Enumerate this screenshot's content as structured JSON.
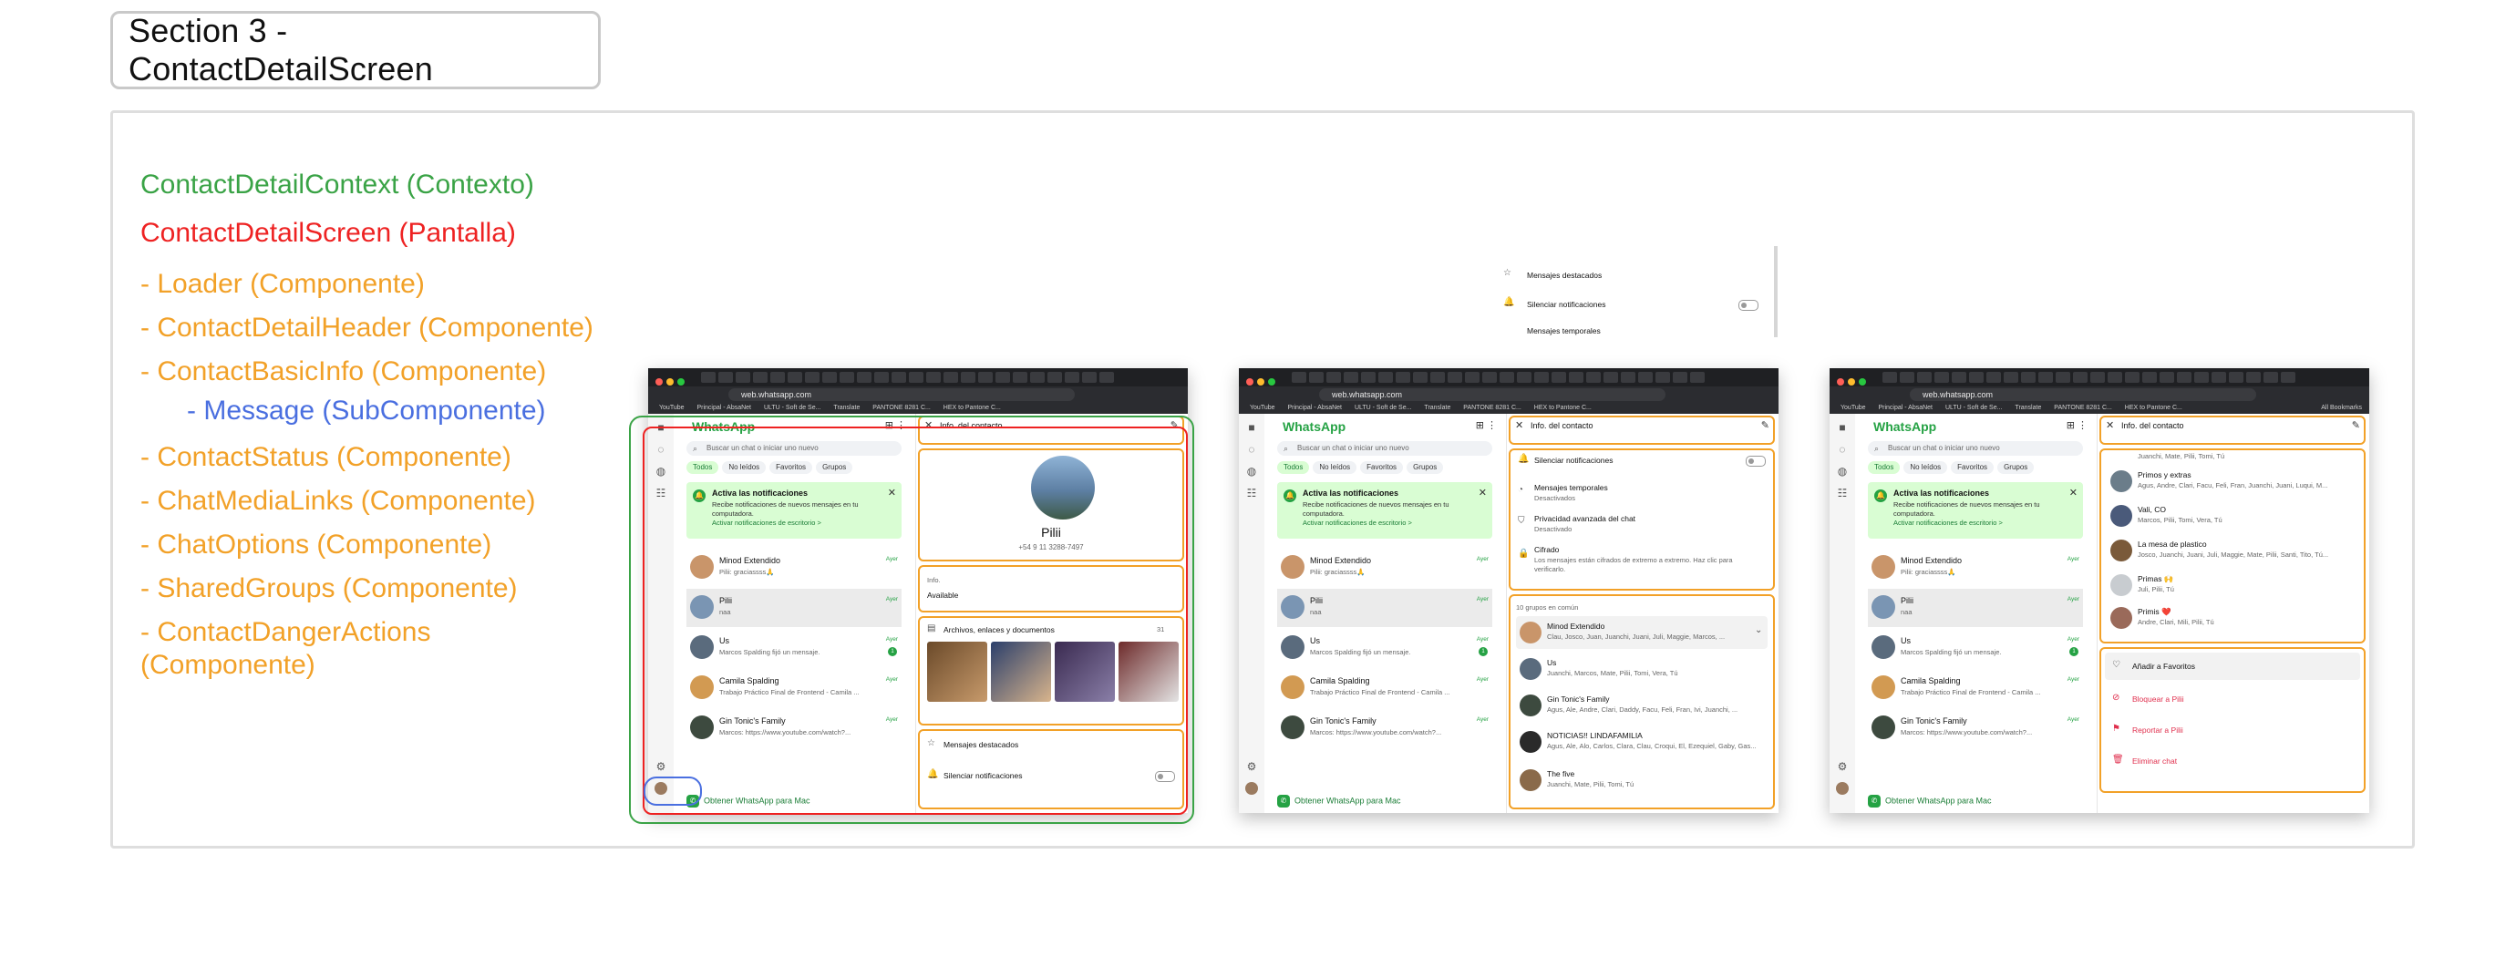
{
  "section_title": "Section 3 - ContactDetailScreen",
  "legend": [
    {
      "text": "ContactDetailContext (Contexto)",
      "color": "green"
    },
    {
      "text": "ContactDetailScreen (Pantalla)",
      "color": "red"
    },
    {
      "text": "- Loader (Componente)",
      "color": "orange"
    },
    {
      "text": "- ContactDetailHeader (Componente)",
      "color": "orange"
    },
    {
      "text": "- ContactBasicInfo (Componente)",
      "color": "orange"
    },
    {
      "text": "- Message (SubComponente)",
      "color": "blue"
    },
    {
      "text": "- ContactStatus (Componente)",
      "color": "orange"
    },
    {
      "text": "- ChatMediaLinks (Componente)",
      "color": "orange"
    },
    {
      "text": "- ChatOptions (Componente)",
      "color": "orange"
    },
    {
      "text": "- SharedGroups (Componente)",
      "color": "orange"
    },
    {
      "text": "- ContactDangerActions",
      "color": "orange"
    },
    {
      "text": "(Componente)",
      "color": "orange"
    }
  ],
  "colors": {
    "green": "#3aa346",
    "red": "#ee2222",
    "orange": "#f2a128",
    "blue": "#4a6fe0",
    "wa_green": "#25a244"
  },
  "browser": {
    "url": "web.whatsapp.com",
    "bookmarks": [
      "YouTube",
      "Principal - AbsaNet",
      "ULTU - Soft de Se...",
      "Translate",
      "PANTONE 8281 C...",
      "HEX to Pantone C..."
    ],
    "all_bookmarks": "All Bookmarks"
  },
  "wa": {
    "title": "WhatsApp",
    "search_placeholder": "Buscar un chat o iniciar uno nuevo",
    "filters": [
      "Todos",
      "No leídos",
      "Favoritos",
      "Grupos"
    ],
    "banner": {
      "title": "Activa las notificaciones",
      "text": "Recibe notificaciones de nuevos mensajes en tu computadora.",
      "link": "Activar notificaciones de escritorio >"
    },
    "chats": [
      {
        "name": "Minod Extendido",
        "last": "Pilii: graciassss🙏",
        "time": "Ayer"
      },
      {
        "name": "Pilii",
        "last": "naa",
        "time": "Ayer"
      },
      {
        "name": "Us",
        "last": "Marcos Spalding fijó un mensaje.",
        "time": "Ayer",
        "badge": "1"
      },
      {
        "name": "Camila Spalding",
        "last": "Trabajo Práctico Final de Frontend - Camila ...",
        "time": "Ayer"
      },
      {
        "name": "Gin Tonic's Family",
        "last": "Marcos: https://www.youtube.com/watch?...",
        "time": "Ayer"
      }
    ],
    "get_app": "Obtener WhatsApp para Mac"
  },
  "info": {
    "header": "Info. del contacto",
    "contact_name": "Pilii",
    "phone": "+54 9 11 3288-7497",
    "info_label": "Info.",
    "status": "Available",
    "media_label": "Archivos, enlaces y documentos",
    "media_count": "31",
    "starred": "Mensajes destacados",
    "mute": "Silenciar notificaciones",
    "temporary": "Mensajes temporales",
    "temporary_sub": "Desactivados",
    "privacy": "Privacidad avanzada del chat",
    "privacy_sub": "Desactivado",
    "encryption": "Cifrado",
    "encryption_sub": "Los mensajes están cifrados de extremo a extremo. Haz clic para verificarlo.",
    "groups_count": "10 grupos en común",
    "groups": [
      {
        "name": "Minod Extendido",
        "members": "Clau, Josco, Juan, Juanchi, Juani, Juli, Maggie, Marcos, ..."
      },
      {
        "name": "Us",
        "members": "Juanchi, Marcos, Mate, Pilii, Tomi, Vera, Tú"
      },
      {
        "name": "Gin Tonic's Family",
        "members": "Agus, Ale, Andre, Clari, Daddy, Facu, Feli, Fran, Ivi, Juanchi, ..."
      },
      {
        "name": "NOTICIAS!! LINDAFAMILIA",
        "members": "Agus, Ale, Alo, Carlos, Clara, Clau, Croqui, El, Ezequiel, Gaby, Gas..."
      },
      {
        "name": "The five",
        "members": "Juanchi, Mate, Pilii, Tomi, Tú"
      }
    ],
    "groups2": [
      {
        "name": "The five",
        "members": "Juanchi, Mate, Pilii, Tomi, Tú"
      },
      {
        "name": "Primos y extras",
        "members": "Agus, Andre, Clari, Facu, Feli, Fran, Juanchi, Juani, Luqui, M..."
      },
      {
        "name": "Vali, CO",
        "members": "Marcos, Pilii, Tomi, Vera, Tú"
      },
      {
        "name": "La mesa de plastico",
        "members": "Josco, Juanchi, Juani, Juli, Maggie, Mate, Pilii, Santi, Tito, Tú..."
      },
      {
        "name": "Primas 🙌",
        "members": "Juli, Pilii, Tú"
      },
      {
        "name": "Primis ❤️",
        "members": "Andre, Clari, Mili, Pilii, Tú"
      }
    ],
    "add_fav": "Añadir a Favoritos",
    "block": "Bloquear a Pilii",
    "report": "Reportar a Pilii",
    "delete": "Eliminar chat"
  }
}
